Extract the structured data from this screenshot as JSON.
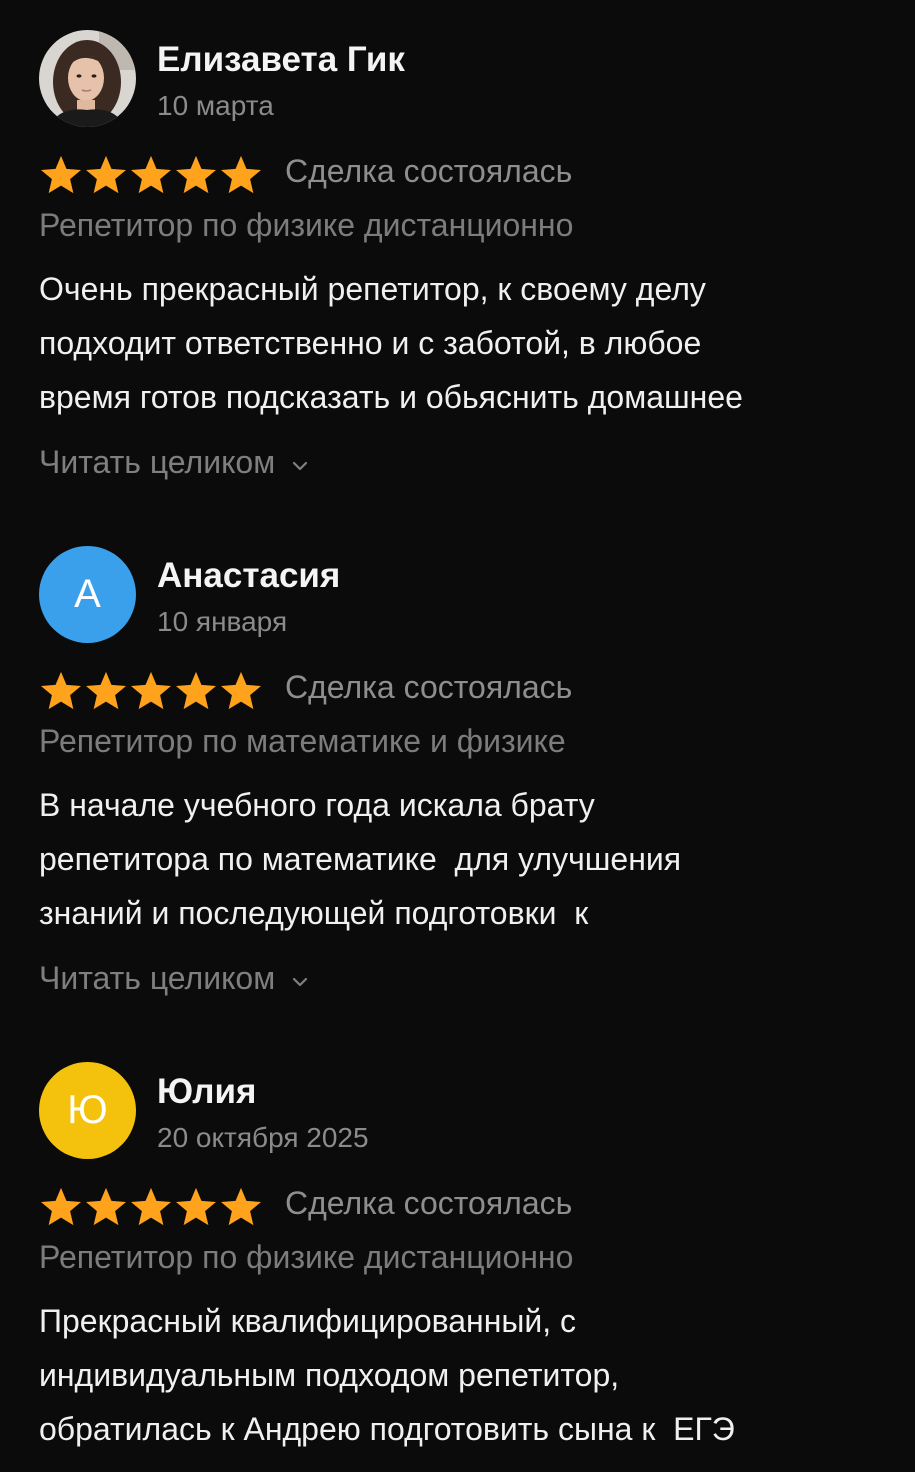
{
  "reviews": [
    {
      "author": "Елизавета Гик",
      "date": "10 марта",
      "avatar": {
        "type": "photo",
        "icon": "user-photo"
      },
      "rating": 5,
      "deal_status": "Сделка состоялась",
      "service": "Репетитор по физике дистанционно",
      "text_lines": [
        "Очень прекрасный репетитор, к своему делу",
        "подходит ответственно и с заботой, в любое",
        "время готов подсказать и обьяснить домашнее"
      ],
      "read_more": "Читать целиком"
    },
    {
      "author": "Анастасия",
      "date": "10 января",
      "avatar": {
        "type": "letter",
        "letter": "А",
        "color": "#3aa0ec"
      },
      "rating": 5,
      "deal_status": "Сделка состоялась",
      "service": "Репетитор по математике и физике",
      "text_lines": [
        "В начале учебного года искала брату",
        "репетитора по математике  для улучшения",
        "знаний и последующей подготовки  к"
      ],
      "read_more": "Читать целиком"
    },
    {
      "author": "Юлия",
      "date": "20 октября 2025",
      "avatar": {
        "type": "letter",
        "letter": "Ю",
        "color": "#f4c20d"
      },
      "rating": 5,
      "deal_status": "Сделка состоялась",
      "service": "Репетитор по физике дистанционно",
      "text_lines": [
        "Прекрасный квалифицированный, с",
        "индивидуальным подходом репетитор,",
        "обратилась к Андрею подготовить сына к  ЕГЭ"
      ]
    }
  ],
  "colors": {
    "background": "#0b0b0b",
    "star": "#ffa21c",
    "muted_text": "#8b8b8b"
  }
}
